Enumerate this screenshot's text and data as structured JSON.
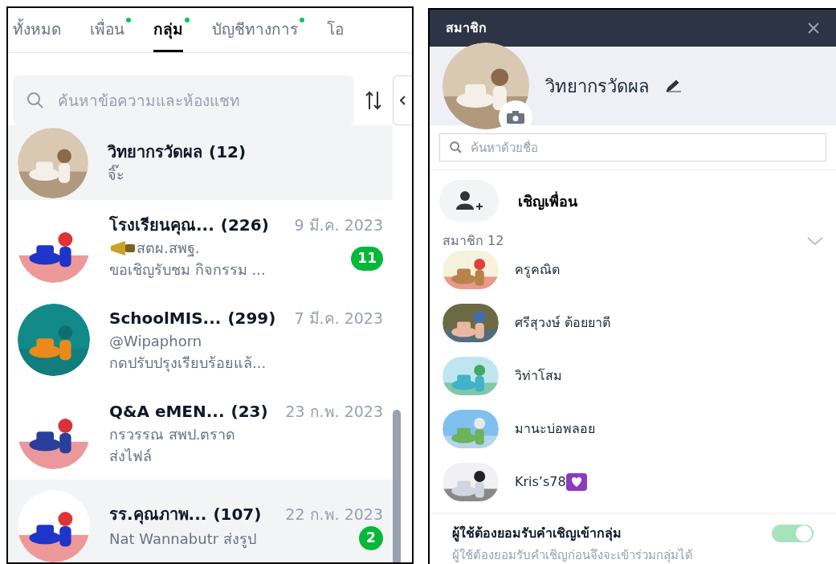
{
  "chat_panel": {
    "tabs": [
      {
        "label": "ทั้งหมด",
        "selected": false,
        "dot": false
      },
      {
        "label": "เพื่อน",
        "selected": false,
        "dot": true
      },
      {
        "label": "กลุ่ม",
        "selected": true,
        "dot": true
      },
      {
        "label": "บัญชีทางการ",
        "selected": false,
        "dot": true
      },
      {
        "label": "โอ",
        "selected": false,
        "dot": false
      }
    ],
    "search": {
      "placeholder": "ค้นหาข้อความและห้องแชท"
    },
    "chats": [
      {
        "name": "วิทยากรวัดผล",
        "count": "(12)",
        "lines": [
          "จิ๊ะ"
        ],
        "selected": true
      },
      {
        "name": "โรงเรียนคุณ...",
        "count": "(226)",
        "date": "9 มี.ค. 2023",
        "lead_icon": true,
        "lines": [
          "สตผ.สพฐ.",
          "ขอเชิญรับชม กิจกรรม ..."
        ],
        "badge": "11",
        "selected": false
      },
      {
        "name": "SchoolMIS...",
        "count": "(299)",
        "date": "7 มี.ค. 2023",
        "lines": [
          "@Wipaphorn",
          "กดปรับปรุงเรียบร้อยแล้..."
        ],
        "selected": false
      },
      {
        "name": "Q&A eMEN...",
        "count": "(23)",
        "date": "23 ก.พ. 2023",
        "lines": [
          "กรวรรณ สพป.ตราด",
          "ส่งไฟล์"
        ],
        "selected": false
      },
      {
        "name": "รร.คุณภาพ...",
        "count": "(107)",
        "date": "22 ก.พ. 2023",
        "lines": [
          "Nat Wannabutr ส่งรูป"
        ],
        "badge": "2",
        "selected": true
      }
    ]
  },
  "members_panel": {
    "title": "สมาชิก",
    "group_name": "วิทยากรวัดผล",
    "search": {
      "placeholder": "ค้นหาด้วยชื่อ"
    },
    "invite": "เชิญเพื่อน",
    "members_heading": "สมาชิก 12",
    "members": [
      {
        "name": "ครูคณิต"
      },
      {
        "name": "ศรีสุวงษ์ ต้อยยาตี"
      },
      {
        "name": "วิท่าโสม"
      },
      {
        "name": "มานะบ่อพลอย"
      },
      {
        "name": "Kris’s78",
        "tail_icon": true
      }
    ],
    "setting": {
      "title": "ผู้ใช้ต้องยอมรับคำเชิญเข้ากลุ่ม",
      "description": "ผู้ใช้ต้องยอมรับคำเชิญก่อนจึงจะเข้าร่วมกลุ่มได้",
      "on": true
    }
  }
}
